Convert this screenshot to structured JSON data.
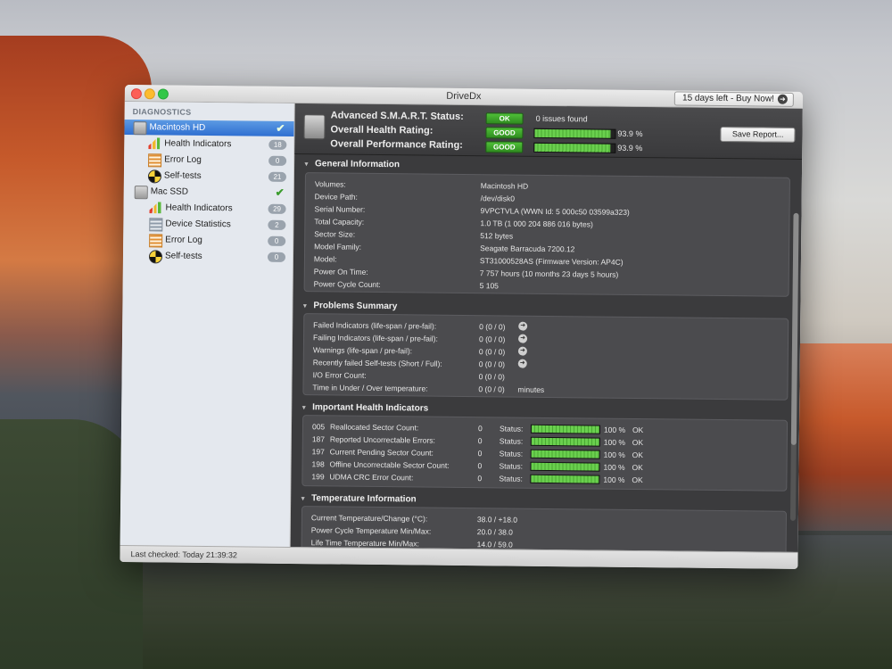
{
  "window": {
    "title": "DriveDx",
    "trial_button": "15 days left - Buy Now!"
  },
  "sidebar": {
    "header": "DIAGNOSTICS",
    "drives": [
      {
        "name": "Macintosh HD",
        "items": [
          {
            "label": "Health Indicators",
            "badge": "18"
          },
          {
            "label": "Error Log",
            "badge": "0"
          },
          {
            "label": "Self-tests",
            "badge": "21"
          }
        ]
      },
      {
        "name": "Mac SSD",
        "items": [
          {
            "label": "Health Indicators",
            "badge": "29"
          },
          {
            "label": "Device Statistics",
            "badge": "2"
          },
          {
            "label": "Error Log",
            "badge": "0"
          },
          {
            "label": "Self-tests",
            "badge": "0"
          }
        ]
      }
    ],
    "last_checked": "Last checked: Today 21:39:32"
  },
  "summary": {
    "smart_label": "Advanced S.M.A.R.T. Status:",
    "smart_value": "OK",
    "issues": "0 issues found",
    "health_label": "Overall Health Rating:",
    "health_value": "GOOD",
    "health_pct": "93.9 %",
    "health_fraction": 0.939,
    "perf_label": "Overall Performance Rating:",
    "perf_value": "GOOD",
    "perf_pct": "93.9 %",
    "perf_fraction": 0.939,
    "save_button": "Save Report..."
  },
  "general": {
    "title": "General Information",
    "rows": [
      {
        "k": "Volumes:",
        "v": "Macintosh HD"
      },
      {
        "k": "Device Path:",
        "v": "/dev/disk0"
      },
      {
        "k": "Serial Number:",
        "v": "9VPCTVLA (WWN Id: 5 000c50 03599a323)"
      },
      {
        "k": "Total Capacity:",
        "v": "1.0 TB (1 000 204 886 016 bytes)"
      },
      {
        "k": "Sector Size:",
        "v": "512 bytes"
      },
      {
        "k": "Model Family:",
        "v": "Seagate Barracuda 7200.12"
      },
      {
        "k": "Model:",
        "v": "ST31000528AS  (Firmware Version: AP4C)"
      },
      {
        "k": "Power On Time:",
        "v": "7 757 hours (10 months 23 days 5 hours)"
      },
      {
        "k": "Power Cycle Count:",
        "v": "5 105"
      }
    ]
  },
  "problems": {
    "title": "Problems Summary",
    "rows": [
      {
        "k": "Failed Indicators (life-span / pre-fail):",
        "v": "0 (0 / 0)"
      },
      {
        "k": "Failing Indicators (life-span / pre-fail):",
        "v": "0 (0 / 0)"
      },
      {
        "k": "Warnings (life-span / pre-fail):",
        "v": "0 (0 / 0)"
      },
      {
        "k": "Recently failed Self-tests (Short / Full):",
        "v": "0 (0 / 0)"
      },
      {
        "k": "I/O Error Count:",
        "v": "0 (0 / 0)"
      },
      {
        "k": "Time in Under / Over temperature:",
        "v": "0 (0 / 0)",
        "unit": "minutes"
      }
    ]
  },
  "health": {
    "title": "Important Health Indicators",
    "status_label": "Status:",
    "rows": [
      {
        "id": "005",
        "name": "Reallocated Sector Count:",
        "value": "0",
        "pct": "100 %",
        "state": "OK",
        "fraction": 1.0
      },
      {
        "id": "187",
        "name": "Reported Uncorrectable Errors:",
        "value": "0",
        "pct": "100 %",
        "state": "OK",
        "fraction": 1.0
      },
      {
        "id": "197",
        "name": "Current Pending Sector Count:",
        "value": "0",
        "pct": "100 %",
        "state": "OK",
        "fraction": 1.0
      },
      {
        "id": "198",
        "name": "Offline Uncorrectable Sector Count:",
        "value": "0",
        "pct": "100 %",
        "state": "OK",
        "fraction": 1.0
      },
      {
        "id": "199",
        "name": "UDMA CRC Error Count:",
        "value": "0",
        "pct": "100 %",
        "state": "OK",
        "fraction": 1.0
      }
    ]
  },
  "temperature": {
    "title": "Temperature Information",
    "rows": [
      {
        "k": "Current Temperature/Change (°C):",
        "v": "38.0 / +18.0"
      },
      {
        "k": "Power Cycle Temperature Min/Max:",
        "v": "20.0 / 38.0"
      },
      {
        "k": "Life Time Temperature Min/Max:",
        "v": "14.0 / 59.0"
      }
    ]
  }
}
